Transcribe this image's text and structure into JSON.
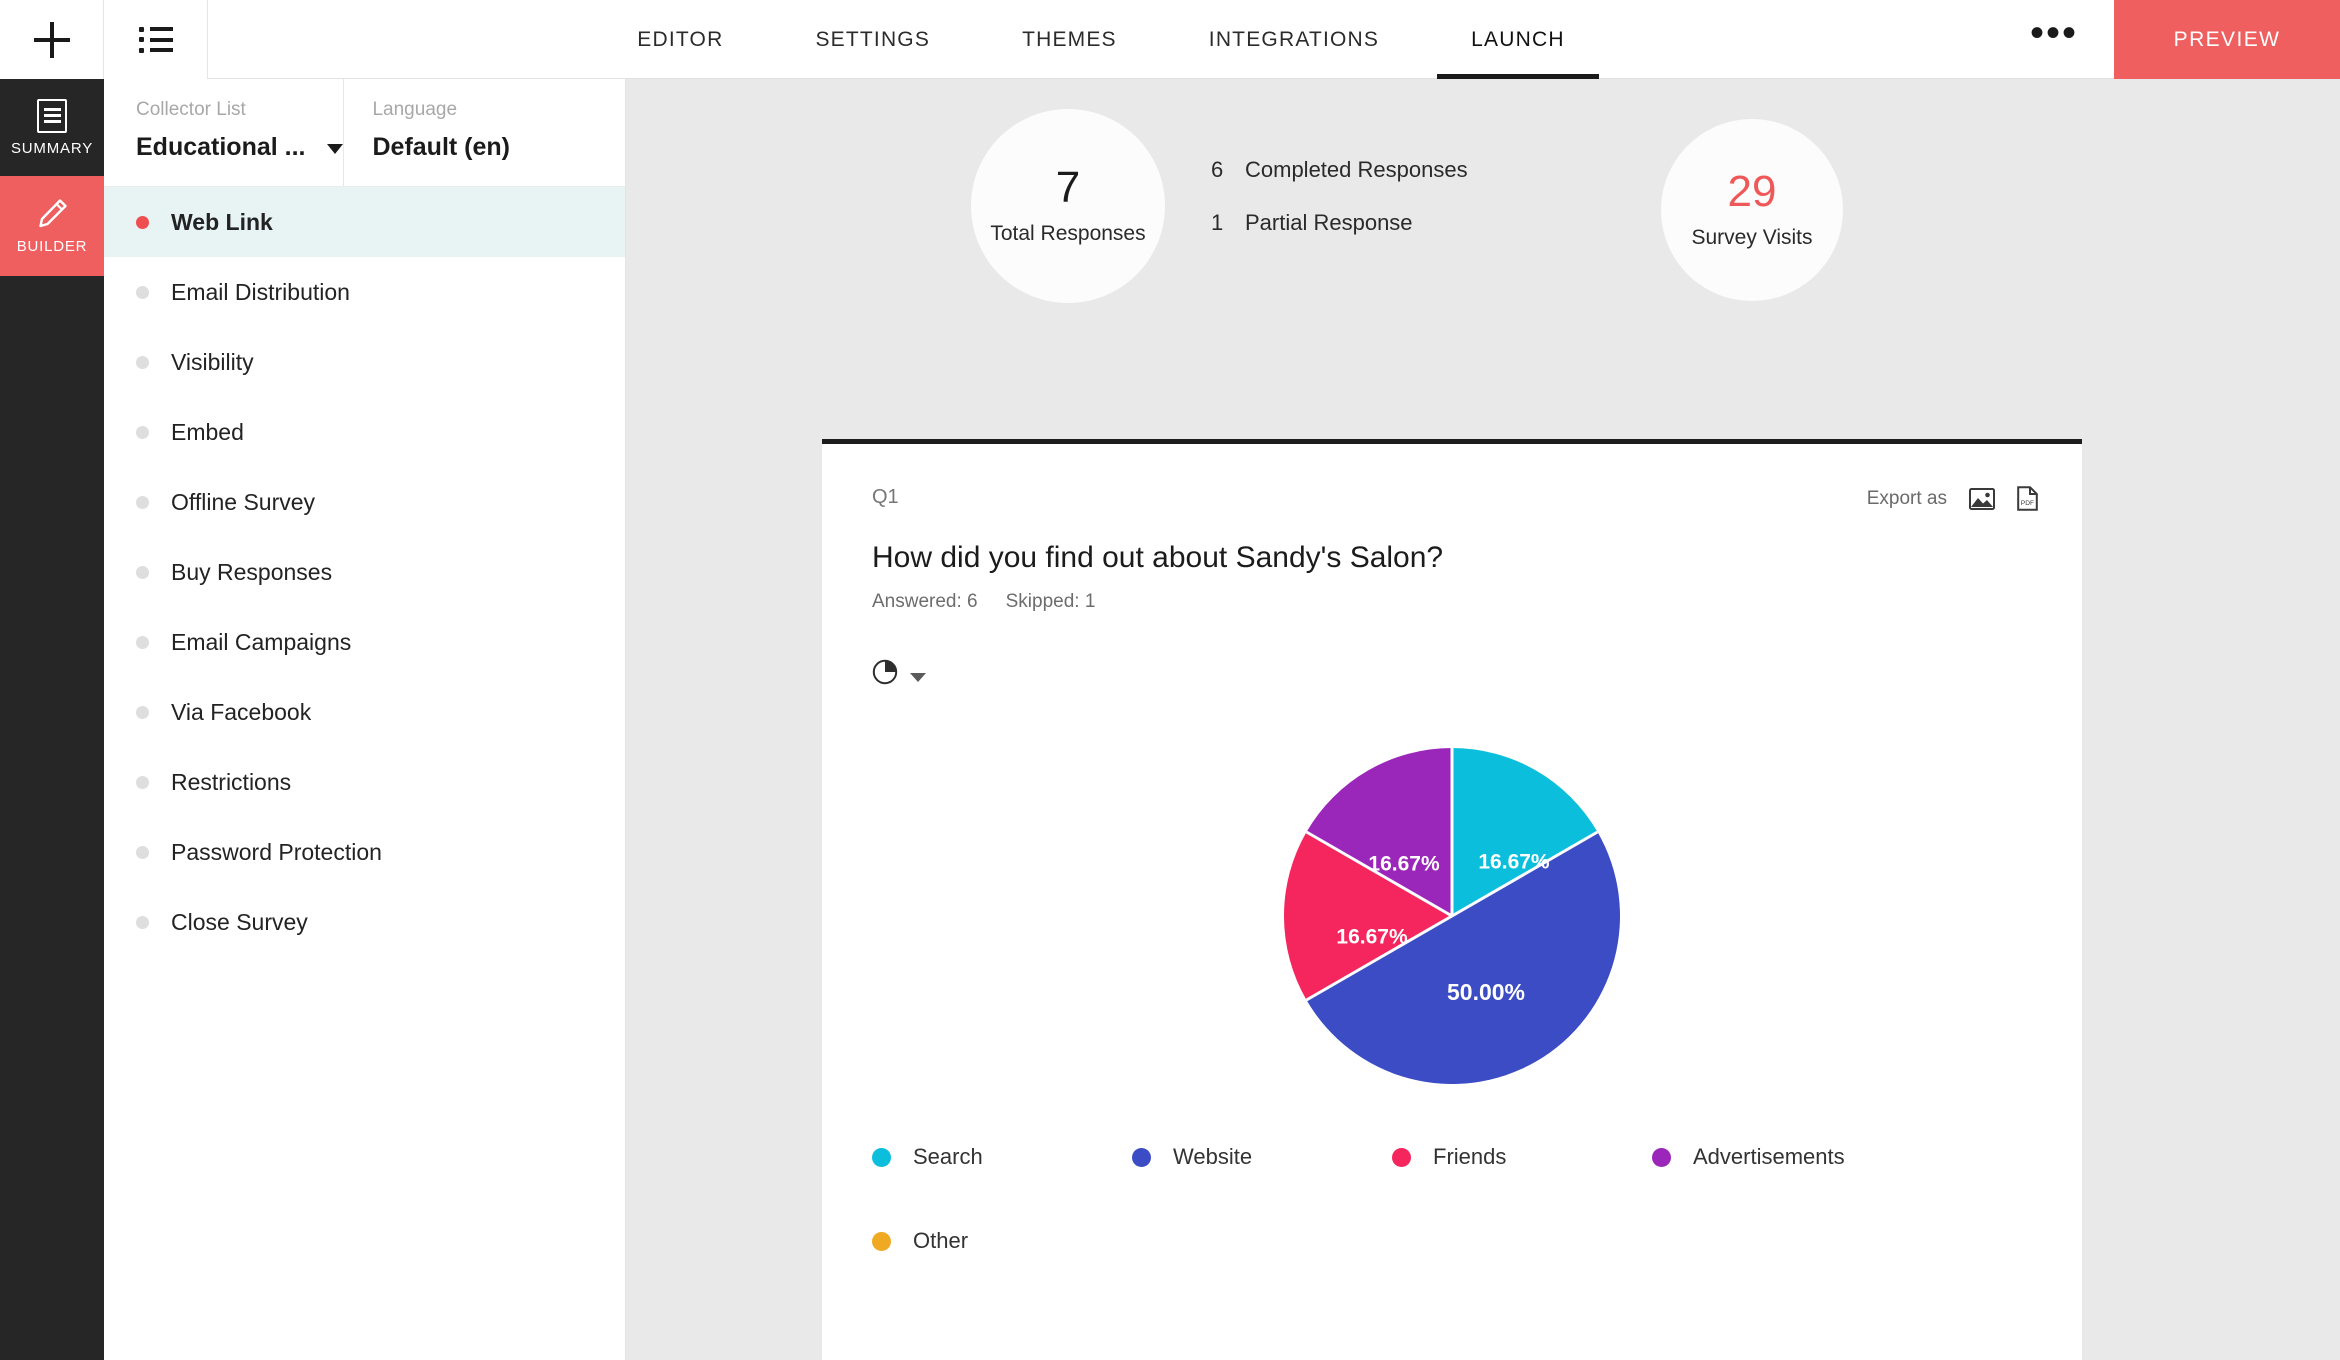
{
  "topbar": {
    "add_icon": "plus-icon",
    "list_icon": "list-icon",
    "tabs": [
      {
        "label": "EDITOR",
        "active": false
      },
      {
        "label": "SETTINGS",
        "active": false
      },
      {
        "label": "THEMES",
        "active": false
      },
      {
        "label": "INTEGRATIONS",
        "active": false
      },
      {
        "label": "LAUNCH",
        "active": true
      }
    ],
    "more_label": "•••",
    "preview_label": "PREVIEW"
  },
  "rail": {
    "items": [
      {
        "label": "SUMMARY",
        "icon": "document-icon",
        "active": false
      },
      {
        "label": "BUILDER",
        "icon": "pencil-icon",
        "active": true
      }
    ]
  },
  "collector": {
    "collector_list_label": "Collector List",
    "collector_list_value": "Educational ...",
    "language_label": "Language",
    "language_value": "Default (en)",
    "items": [
      {
        "label": "Web Link",
        "active": true
      },
      {
        "label": "Email Distribution",
        "active": false
      },
      {
        "label": "Visibility",
        "active": false
      },
      {
        "label": "Embed",
        "active": false
      },
      {
        "label": "Offline Survey",
        "active": false
      },
      {
        "label": "Buy Responses",
        "active": false
      },
      {
        "label": "Email Campaigns",
        "active": false
      },
      {
        "label": "Via Facebook",
        "active": false
      },
      {
        "label": "Restrictions",
        "active": false
      },
      {
        "label": "Password Protection",
        "active": false
      },
      {
        "label": "Close Survey",
        "active": false
      }
    ]
  },
  "stats": {
    "total_responses_value": "7",
    "total_responses_label": "Total Responses",
    "completed_count": "6",
    "completed_label": "Completed Responses",
    "partial_count": "1",
    "partial_label": "Partial Response",
    "survey_visits_value": "29",
    "survey_visits_label": "Survey Visits"
  },
  "question_card": {
    "question_number": "Q1",
    "export_label": "Export as",
    "export_image_icon": "image-export-icon",
    "export_pdf_icon": "pdf-export-icon",
    "title": "How did you find out about Sandy's Salon?",
    "answered": "Answered: 6",
    "skipped": "Skipped: 1",
    "chart_type_icon": "pie-chart-icon"
  },
  "colors": {
    "accent_red": "#ef5f5f",
    "active_bullet": "#ef4f4f",
    "rail_dark": "#262626",
    "survey_visits_number": "#ef5858",
    "card_top_border": "#1d1d1d"
  },
  "chart_data": {
    "type": "pie",
    "title": "How did you find out about Sandy's Salon?",
    "categories": [
      "Search",
      "Website",
      "Friends",
      "Advertisements",
      "Other"
    ],
    "values": [
      16.67,
      50.0,
      16.67,
      16.67,
      0
    ],
    "labels": [
      "16.67%",
      "50.00%",
      "16.67%",
      "16.67%",
      ""
    ],
    "colors": [
      "#0ABEDC",
      "#3B4CC4",
      "#F5255E",
      "#9B27BA",
      "#F0A922"
    ],
    "legend_position": "bottom",
    "grid": false,
    "value_unit": "%",
    "answered": 6,
    "skipped": 1
  }
}
